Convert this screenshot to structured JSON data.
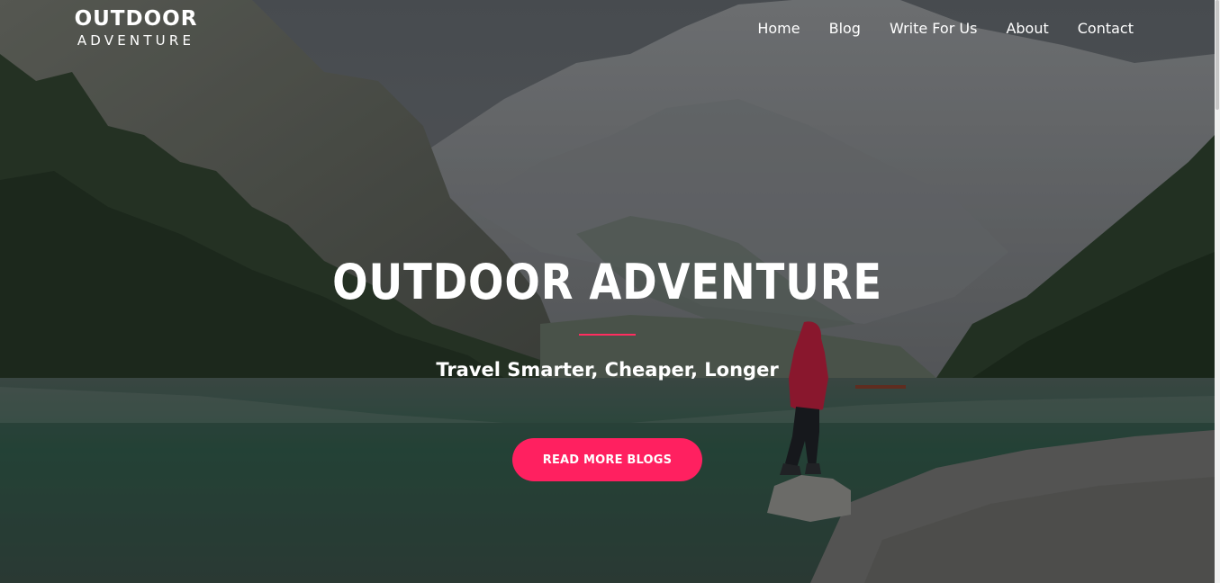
{
  "brand": {
    "line1": "OUTDOOR",
    "line2": "ADVENTURE"
  },
  "nav": {
    "items": [
      {
        "label": "Home"
      },
      {
        "label": "Blog"
      },
      {
        "label": "Write For Us"
      },
      {
        "label": "About"
      },
      {
        "label": "Contact"
      }
    ]
  },
  "hero": {
    "title": "OUTDOOR ADVENTURE",
    "subtitle": "Travel Smarter, Cheaper, Longer",
    "cta_label": "READ MORE BLOGS",
    "background_image": "mountain-lake-hiker",
    "accent_color": "#ff2060"
  }
}
